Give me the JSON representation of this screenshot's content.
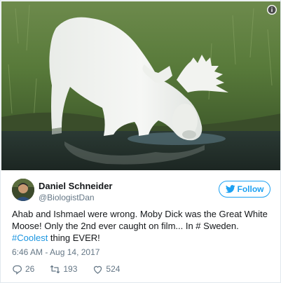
{
  "media": {
    "description_icon": "info-icon"
  },
  "author": {
    "display_name": "Daniel Schneider",
    "handle": "@BiologistDan",
    "avatar_icon": "avatar"
  },
  "follow_button": {
    "label": "Follow",
    "icon": "bird-icon"
  },
  "tweet": {
    "line1": "Ahab and Ishmael were wrong. Moby Dick was the Great White",
    "line2": "Moose! Only the 2nd ever caught on film... In # Sweden.",
    "hashtag": "#Coolest",
    "line3_rest": " thing EVER!",
    "timestamp": "6:46 AM - Aug 14, 2017"
  },
  "actions": {
    "reply_count": "26",
    "retweet_count": "193",
    "like_count": "524"
  },
  "colors": {
    "link_blue": "#1da1f2",
    "hashtag_blue": "#1b95e0",
    "secondary_text": "#657786",
    "primary_text": "#14171a"
  }
}
